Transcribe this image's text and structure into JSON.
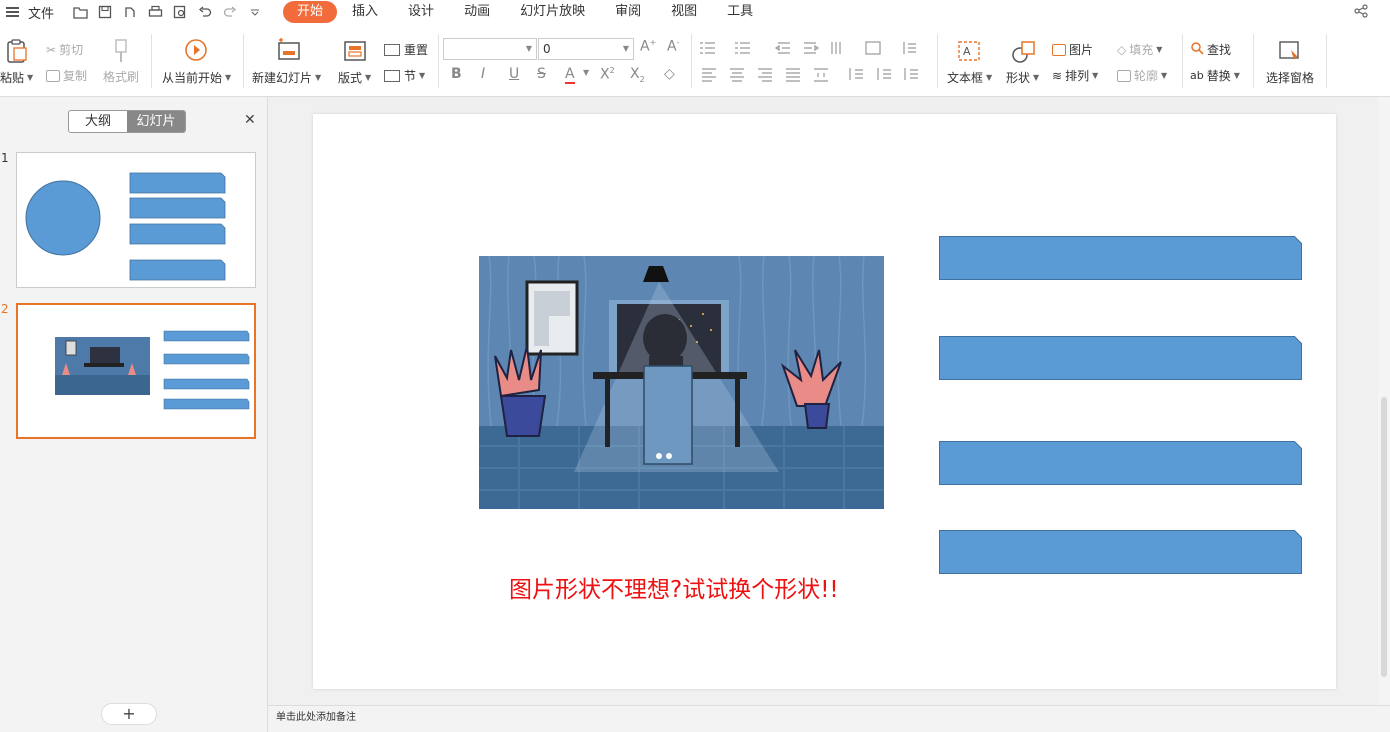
{
  "menu": {
    "file": "文件",
    "tabs": [
      "开始",
      "插入",
      "设计",
      "动画",
      "幻灯片放映",
      "审阅",
      "视图",
      "工具"
    ],
    "active_tab": "开始"
  },
  "ribbon": {
    "paste": "粘贴",
    "cut": "剪切",
    "copy": "复制",
    "format_painter": "格式刷",
    "from_current": "从当前开始",
    "new_slide": "新建幻灯片",
    "layout": "版式",
    "reset": "重置",
    "section": "节",
    "font_size": "0",
    "textbox": "文本框",
    "shape": "形状",
    "picture": "图片",
    "arrange": "排列",
    "fill": "填充",
    "outline": "轮廓",
    "find": "查找",
    "replace": "替换",
    "select_pane": "选择窗格"
  },
  "panel": {
    "outline_tab": "大纲",
    "slides_tab": "幻灯片",
    "slide_numbers": [
      "1",
      "2"
    ],
    "add_label": "+"
  },
  "slide": {
    "caption": "图片形状不理想?试试换个形状!!",
    "shape_color": "#5b9bd5"
  },
  "notes": {
    "placeholder": "单击此处添加备注"
  },
  "colors": {
    "accent": "#f26b3a",
    "selection": "#e8742a",
    "caption": "#ee1111",
    "shape_fill": "#5b9bd5",
    "shape_stroke": "#41719c"
  }
}
